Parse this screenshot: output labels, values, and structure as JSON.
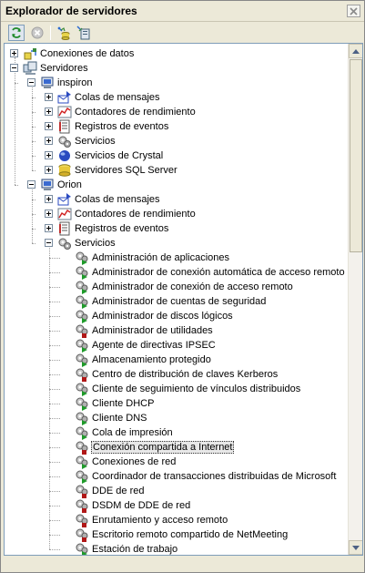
{
  "window": {
    "title": "Explorador de servidores"
  },
  "icons": {
    "close": "close-icon",
    "refresh": "refresh-icon",
    "stop": "stop-icon",
    "connect_database": "connect-database-icon",
    "connect_server": "connect-server-icon"
  },
  "tree": {
    "nodes": [
      {
        "label": "Conexiones de datos",
        "level": 0,
        "expander": "plus",
        "icon": "data-connections"
      },
      {
        "label": "Servidores",
        "level": 0,
        "expander": "minus",
        "icon": "servers"
      },
      {
        "label": "inspiron",
        "level": 1,
        "expander": "minus",
        "icon": "computer"
      },
      {
        "label": "Colas de mensajes",
        "level": 2,
        "expander": "plus",
        "icon": "message-queue"
      },
      {
        "label": "Contadores de rendimiento",
        "level": 2,
        "expander": "plus",
        "icon": "perf-counter"
      },
      {
        "label": "Registros de eventos",
        "level": 2,
        "expander": "plus",
        "icon": "event-log"
      },
      {
        "label": "Servicios",
        "level": 2,
        "expander": "plus",
        "icon": "services"
      },
      {
        "label": "Servicios de Crystal",
        "level": 2,
        "expander": "plus",
        "icon": "crystal"
      },
      {
        "label": "Servidores SQL Server",
        "level": 2,
        "expander": "plus",
        "icon": "sql-server"
      },
      {
        "label": "Orion",
        "level": 1,
        "expander": "minus",
        "icon": "computer"
      },
      {
        "label": "Colas de mensajes",
        "level": 2,
        "expander": "plus",
        "icon": "message-queue"
      },
      {
        "label": "Contadores de rendimiento",
        "level": 2,
        "expander": "plus",
        "icon": "perf-counter"
      },
      {
        "label": "Registros de eventos",
        "level": 2,
        "expander": "plus",
        "icon": "event-log"
      },
      {
        "label": "Servicios",
        "level": 2,
        "expander": "minus",
        "icon": "services"
      },
      {
        "label": "Administración de aplicaciones",
        "level": 3,
        "icon": "service-running"
      },
      {
        "label": "Administrador de conexión automática de acceso remoto",
        "level": 3,
        "icon": "service-running"
      },
      {
        "label": "Administrador de conexión de acceso remoto",
        "level": 3,
        "icon": "service-running"
      },
      {
        "label": "Administrador de cuentas de seguridad",
        "level": 3,
        "icon": "service-running"
      },
      {
        "label": "Administrador de discos lógicos",
        "level": 3,
        "icon": "service-running"
      },
      {
        "label": "Administrador de utilidades",
        "level": 3,
        "icon": "service-stopped"
      },
      {
        "label": "Agente de directivas IPSEC",
        "level": 3,
        "icon": "service-running"
      },
      {
        "label": "Almacenamiento protegido",
        "level": 3,
        "icon": "service-running"
      },
      {
        "label": "Centro de distribución de claves Kerberos",
        "level": 3,
        "icon": "service-stopped"
      },
      {
        "label": "Cliente de seguimiento de vínculos distribuidos",
        "level": 3,
        "icon": "service-running"
      },
      {
        "label": "Cliente DHCP",
        "level": 3,
        "icon": "service-running"
      },
      {
        "label": "Cliente DNS",
        "level": 3,
        "icon": "service-running"
      },
      {
        "label": "Cola de impresión",
        "level": 3,
        "icon": "service-running"
      },
      {
        "label": "Conexión compartida a Internet",
        "level": 3,
        "icon": "service-stopped",
        "selected": true
      },
      {
        "label": "Conexiones de red",
        "level": 3,
        "icon": "service-running"
      },
      {
        "label": "Coordinador de transacciones distribuidas de Microsoft",
        "level": 3,
        "icon": "service-running"
      },
      {
        "label": "DDE de red",
        "level": 3,
        "icon": "service-stopped"
      },
      {
        "label": "DSDM de DDE de red",
        "level": 3,
        "icon": "service-stopped"
      },
      {
        "label": "Enrutamiento y acceso remoto",
        "level": 3,
        "icon": "service-stopped"
      },
      {
        "label": "Escritorio remoto compartido de NetMeeting",
        "level": 3,
        "icon": "service-stopped"
      },
      {
        "label": "Estación de trabajo",
        "level": 3,
        "icon": "service-running"
      }
    ]
  }
}
